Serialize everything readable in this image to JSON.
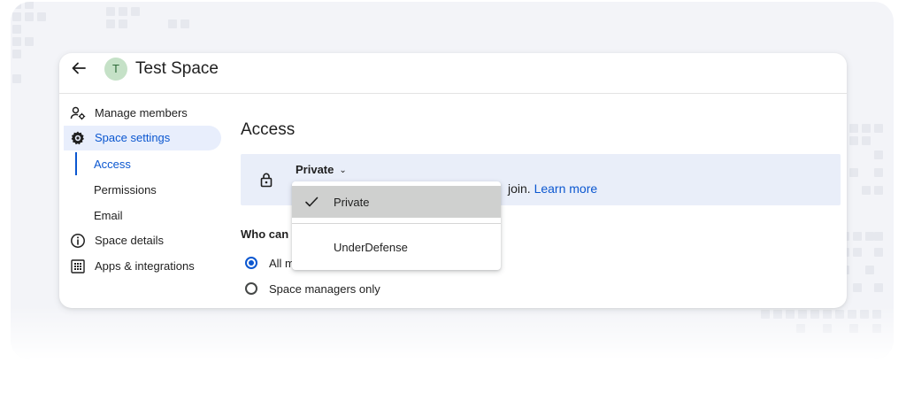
{
  "header": {
    "title": "Test Space",
    "avatar_letter": "T"
  },
  "sidebar": {
    "items": [
      {
        "label": "Manage members",
        "icon": "manage-members-icon"
      },
      {
        "label": "Space settings",
        "icon": "gear-icon",
        "active": true
      },
      {
        "label": "Space details",
        "icon": "info-icon"
      },
      {
        "label": "Apps & integrations",
        "icon": "apps-grid-icon"
      }
    ],
    "subitems": [
      {
        "label": "Access",
        "active": true
      },
      {
        "label": "Permissions"
      },
      {
        "label": "Email"
      }
    ]
  },
  "main": {
    "heading": "Access",
    "access_select": {
      "value": "Private",
      "description_visible": "join.",
      "learn_more": "Learn more"
    },
    "dropdown": {
      "options": [
        {
          "label": "Private",
          "selected": true
        },
        {
          "label": "UnderDefense",
          "selected": false
        }
      ]
    },
    "who_can_label": "Who can",
    "radio_options": [
      {
        "label": "All m",
        "checked": true
      },
      {
        "label": "Space managers only",
        "checked": false
      }
    ]
  },
  "colors": {
    "accent": "#0b57d0",
    "active_nav_bg": "#e8eefc",
    "banner_bg": "#e9eef9",
    "avatar_bg": "#c5e1c7"
  }
}
